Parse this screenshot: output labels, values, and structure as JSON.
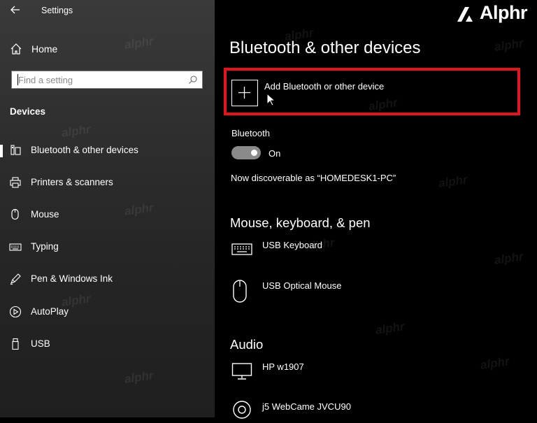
{
  "window": {
    "title": "Settings"
  },
  "brand": {
    "name": "Alphr"
  },
  "sidebar": {
    "home_label": "Home",
    "search_placeholder": "Find a setting",
    "section_title": "Devices",
    "items": [
      {
        "label": "Bluetooth & other devices",
        "icon": "bluetooth-devices-icon",
        "selected": true
      },
      {
        "label": "Printers & scanners",
        "icon": "printer-icon"
      },
      {
        "label": "Mouse",
        "icon": "mouse-icon"
      },
      {
        "label": "Typing",
        "icon": "keyboard-icon"
      },
      {
        "label": "Pen & Windows Ink",
        "icon": "pen-icon"
      },
      {
        "label": "AutoPlay",
        "icon": "autoplay-icon"
      },
      {
        "label": "USB",
        "icon": "usb-icon"
      }
    ]
  },
  "main": {
    "page_title": "Bluetooth & other devices",
    "add_device_label": "Add Bluetooth or other device",
    "bluetooth_label": "Bluetooth",
    "bluetooth_state": "On",
    "discoverable_text": "Now discoverable as “HOMEDESK1-PC”",
    "sections": [
      {
        "title": "Mouse, keyboard, & pen",
        "devices": [
          {
            "label": "USB Keyboard",
            "icon": "keyboard-icon"
          },
          {
            "label": "USB Optical Mouse",
            "icon": "mouse-icon"
          }
        ]
      },
      {
        "title": "Audio",
        "devices": [
          {
            "label": "HP w1907",
            "icon": "monitor-icon"
          },
          {
            "label": "j5 WebCame JVCU90",
            "icon": "webcam-icon"
          }
        ]
      }
    ]
  },
  "colors": {
    "highlight": "#e3141b",
    "toggle": "#8a8a8a"
  }
}
